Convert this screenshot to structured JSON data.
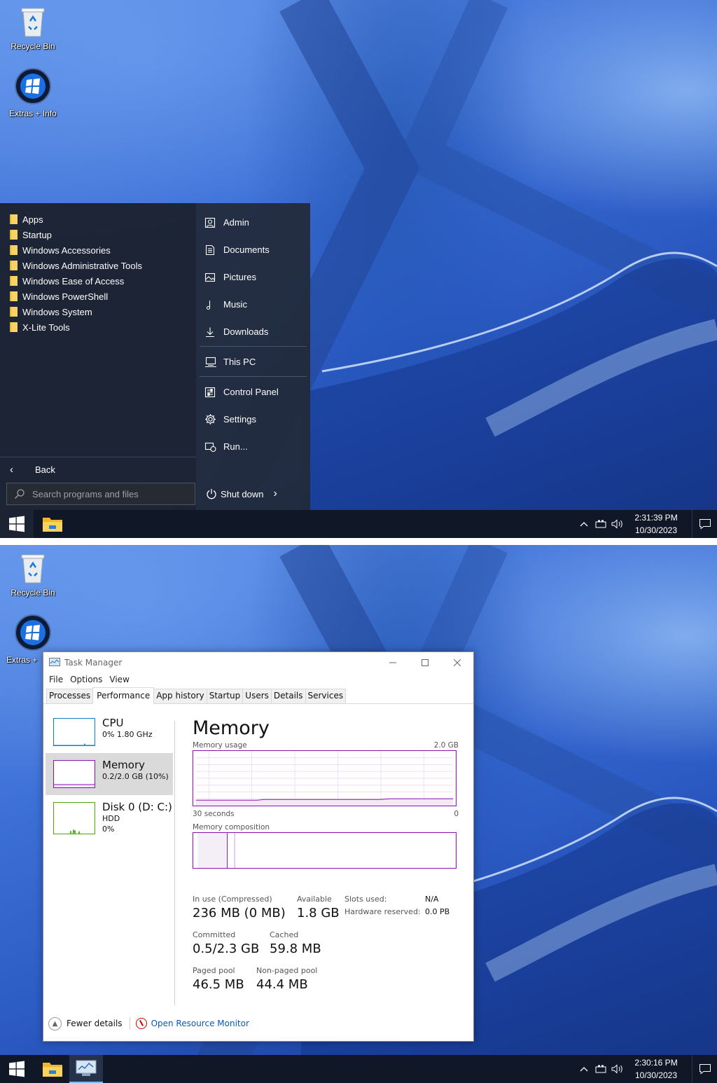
{
  "desktop": {
    "recycle_bin": "Recycle Bin",
    "extras_info": "Extras + Info",
    "extras_info_cropped": "Extras +"
  },
  "start_menu": {
    "folders": [
      "Apps",
      "Startup",
      "Windows Accessories",
      "Windows Administrative Tools",
      "Windows Ease of Access",
      "Windows PowerShell",
      "Windows System",
      "X-Lite Tools"
    ],
    "places": [
      {
        "label": "Admin",
        "icon": "user-icon"
      },
      {
        "label": "Documents",
        "icon": "document-icon"
      },
      {
        "label": "Pictures",
        "icon": "picture-icon"
      },
      {
        "label": "Music",
        "icon": "music-icon"
      },
      {
        "label": "Downloads",
        "icon": "download-icon"
      }
    ],
    "system": [
      {
        "label": "This PC",
        "icon": "computer-icon"
      },
      {
        "label": "Control Panel",
        "icon": "control-panel-icon"
      },
      {
        "label": "Settings",
        "icon": "gear-icon"
      },
      {
        "label": "Run...",
        "icon": "run-icon"
      }
    ],
    "back": "Back",
    "search_placeholder": "Search programs and files",
    "shutdown": "Shut down"
  },
  "taskbar1": {
    "time": "2:31:39 PM",
    "date": "10/30/2023"
  },
  "taskbar2": {
    "time": "2:30:16 PM",
    "date": "10/30/2023"
  },
  "task_manager": {
    "title": "Task Manager",
    "menu": [
      "File",
      "Options",
      "View"
    ],
    "tabs": [
      "Processes",
      "Performance",
      "App history",
      "Startup",
      "Users",
      "Details",
      "Services"
    ],
    "active_tab": "Performance",
    "side": {
      "cpu": {
        "name": "CPU",
        "detail": "0% 1.80 GHz"
      },
      "memory": {
        "name": "Memory",
        "detail": "0.2/2.0 GB (10%)"
      },
      "disk": {
        "name": "Disk 0 (D: C:)",
        "type": "HDD",
        "detail": "0%"
      }
    },
    "main": {
      "title": "Memory",
      "usage_label": "Memory usage",
      "usage_max": "2.0 GB",
      "time_span": "30 seconds",
      "time_zero": "0",
      "composition_label": "Memory composition",
      "in_use_label": "In use (Compressed)",
      "in_use": "236 MB (0 MB)",
      "available_label": "Available",
      "available": "1.8 GB",
      "slots_label": "Slots used:",
      "slots": "N/A",
      "hw_reserved_label": "Hardware reserved:",
      "hw_reserved": "0.0 PB",
      "committed_label": "Committed",
      "committed": "0.5/2.3 GB",
      "cached_label": "Cached",
      "cached": "59.8 MB",
      "paged_label": "Paged pool",
      "paged": "46.5 MB",
      "nonpaged_label": "Non-paged pool",
      "nonpaged": "44.4 MB"
    },
    "footer": {
      "fewer": "Fewer details",
      "resource": "Open Resource Monitor"
    }
  },
  "colors": {
    "memory_accent": "#8b12ae",
    "cpu_accent": "#117dbb",
    "disk_accent": "#4da60c",
    "taskbar": "#101828"
  }
}
